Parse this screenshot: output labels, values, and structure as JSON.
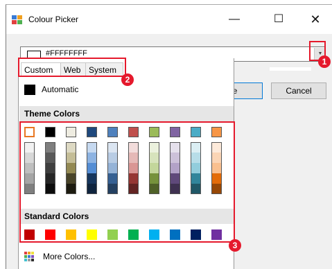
{
  "window": {
    "title": "Colour Picker",
    "minimize_glyph": "—",
    "maximize_glyph": "☐",
    "close_glyph": "✕"
  },
  "colour_combo": {
    "value_text": "#FFFFFFFF",
    "swatch_color": "#FFFFFF",
    "arrow_glyph": "▼"
  },
  "buttons": {
    "ok_visible_text": "e",
    "cancel_label": "Cancel"
  },
  "dropdown": {
    "tabs": [
      {
        "label": "Custom",
        "active": true
      },
      {
        "label": "Web",
        "active": false
      },
      {
        "label": "System",
        "active": false
      }
    ],
    "automatic_label": "Automatic",
    "theme_colors_header": "Theme Colors",
    "standard_colors_header": "Standard Colors",
    "more_colors_label": "More Colors...",
    "theme_top_row": [
      "#FFFFFF",
      "#000000",
      "#EEECE1",
      "#1F497D",
      "#4F81BD",
      "#C0504D",
      "#9BBB59",
      "#8064A2",
      "#4BACC6",
      "#F79646"
    ],
    "theme_shades": [
      [
        "#F2F2F2",
        "#D8D8D8",
        "#BFBFBF",
        "#A5A5A5",
        "#7F7F7F"
      ],
      [
        "#7F7F7F",
        "#595959",
        "#3F3F3F",
        "#262626",
        "#0C0C0C"
      ],
      [
        "#DDD9C3",
        "#C4BD97",
        "#938953",
        "#494429",
        "#1D1B10"
      ],
      [
        "#C6D9F0",
        "#8DB3E2",
        "#548DD4",
        "#17365D",
        "#0F243E"
      ],
      [
        "#DBE5F1",
        "#B8CCE4",
        "#95B3D7",
        "#366092",
        "#244061"
      ],
      [
        "#F2DCDB",
        "#E5B9B7",
        "#D99694",
        "#953734",
        "#632423"
      ],
      [
        "#EBF1DD",
        "#D7E3BC",
        "#C3D69B",
        "#76923C",
        "#4F6128"
      ],
      [
        "#E5E0EC",
        "#CCC1D9",
        "#B2A2C7",
        "#5F497A",
        "#3F3151"
      ],
      [
        "#DBEEF3",
        "#B7DDE8",
        "#92CDDC",
        "#31859B",
        "#205867"
      ],
      [
        "#FDEADA",
        "#FBD5B5",
        "#FAC08F",
        "#E36C09",
        "#974806"
      ]
    ],
    "standard_colors": [
      "#C00000",
      "#FF0000",
      "#FFC000",
      "#FFFF00",
      "#92D050",
      "#00B050",
      "#00B0F0",
      "#0070C0",
      "#002060",
      "#7030A0"
    ]
  },
  "annotations": {
    "badge_1": "1",
    "badge_2": "2",
    "badge_3": "3",
    "accent": "#E5192C"
  }
}
